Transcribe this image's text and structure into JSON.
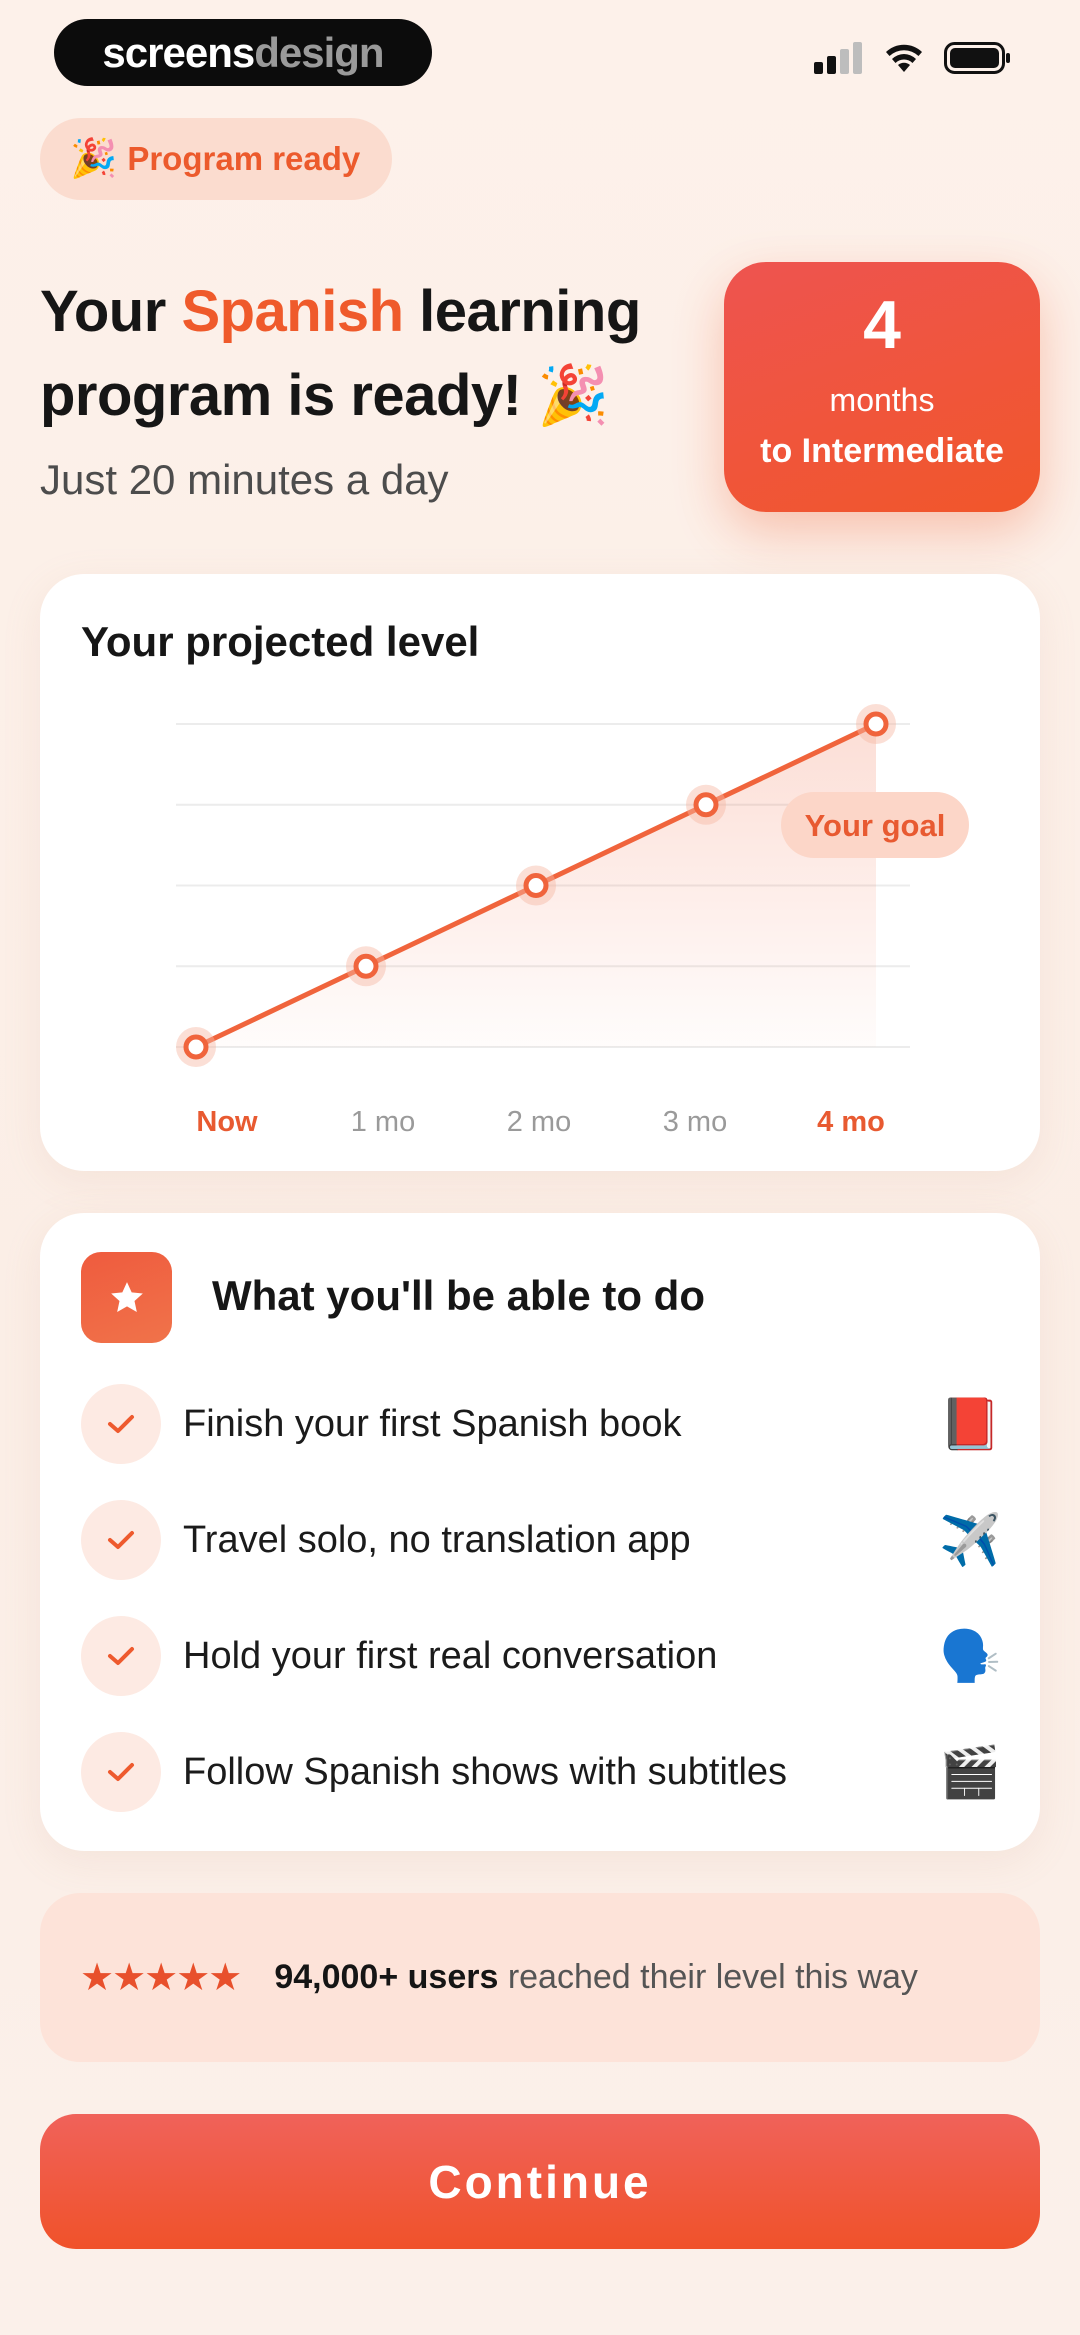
{
  "status_bar": {
    "brand_part1": "screens",
    "brand_part2": "design"
  },
  "pill": {
    "emoji": "🎉",
    "label": "Program ready"
  },
  "headline": {
    "line1_pre": "Your ",
    "line1_accent": "Spanish",
    "line1_post": " learning",
    "line2": "program is ready!",
    "emoji": "🎉",
    "subline": "Just 20 minutes a day"
  },
  "months_box": {
    "number": "4",
    "unit": "months",
    "target": "to Intermediate"
  },
  "chart_data": {
    "type": "line",
    "title": "Your projected level",
    "categories": [
      "Now",
      "1 mo",
      "2 mo",
      "3 mo",
      "4 mo"
    ],
    "values": [
      0,
      1,
      2,
      3,
      4
    ],
    "ylim": [
      0,
      4
    ],
    "grid": true,
    "annotation": "Your goal",
    "accent": "#ef5a2b"
  },
  "abilities": {
    "title": "What you'll be able to do",
    "items": [
      {
        "text": "Finish your first Spanish book",
        "emoji": "📕"
      },
      {
        "text": "Travel solo, no translation app",
        "emoji": "✈️"
      },
      {
        "text": "Hold your first real conversation",
        "emoji": "🗣️"
      },
      {
        "text": "Follow Spanish shows with subtitles",
        "emoji": "🎬"
      }
    ]
  },
  "proof": {
    "stars": "★★★★★",
    "count": "94,000+ users",
    "text": " reached their level this way"
  },
  "cta": {
    "label": "Continue"
  },
  "colors": {
    "accent": "#ef5a2b",
    "background": "#fdf1ea",
    "card": "#ffffff"
  }
}
